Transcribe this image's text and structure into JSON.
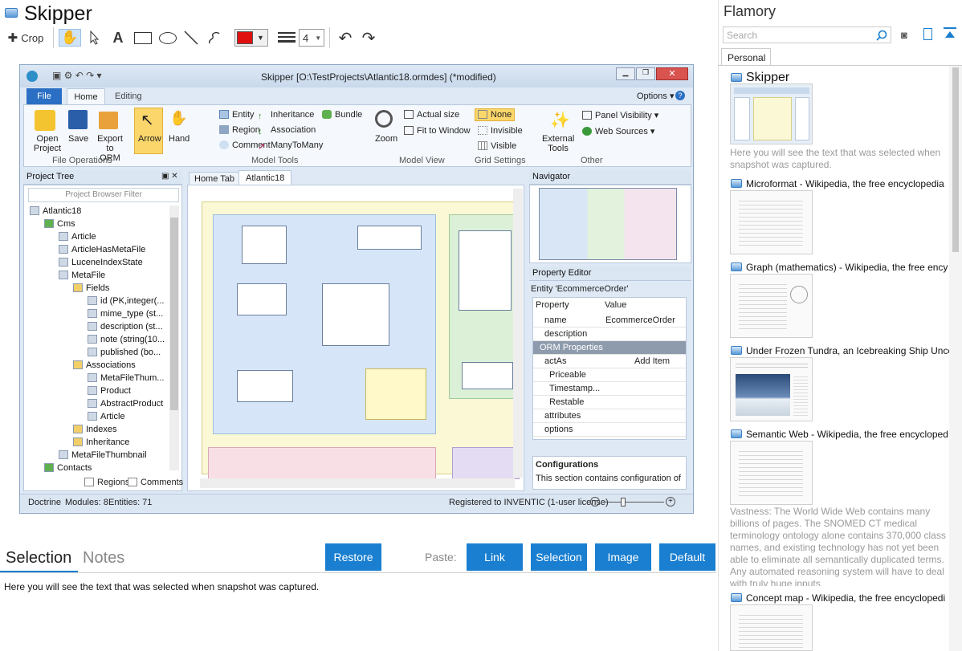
{
  "app": {
    "title": "Skipper"
  },
  "toolbar": {
    "crop_label": "Crop",
    "line_width": "4",
    "color": "#e01010"
  },
  "screenshot": {
    "window_title": "Skipper [O:\\TestProjects\\Atlantic18.ormdes] (*modified)",
    "ribbon_tabs": [
      "File",
      "Home",
      "Editing"
    ],
    "options_label": "Options",
    "file_ops": {
      "open": "Open\nProject",
      "save": "Save",
      "export": "Export\nto ORM",
      "group": "File Operations"
    },
    "arrow": "Arrow",
    "hand": "Hand",
    "model_tools": [
      "Entity",
      "Region",
      "Comment",
      "Inheritance",
      "Association",
      "ManyToMany",
      "Bundle"
    ],
    "model_tools_group": "Model Tools",
    "zoom": "Zoom",
    "actual_size": "Actual size",
    "fit_window": "Fit to Window",
    "model_view_group": "Model View",
    "grid": [
      "None",
      "Invisible",
      "Visible"
    ],
    "grid_group": "Grid Settings",
    "external_tools": "External\nTools",
    "panel_visibility": "Panel Visibility",
    "web_sources": "Web Sources",
    "other_group": "Other",
    "project_tree": "Project Tree",
    "filter_placeholder": "Project Browser Filter",
    "tree_items": [
      {
        "label": "Atlantic18",
        "indent": 0
      },
      {
        "label": "Cms",
        "indent": 1
      },
      {
        "label": "Article",
        "indent": 2
      },
      {
        "label": "ArticleHasMetaFile",
        "indent": 2
      },
      {
        "label": "LuceneIndexState",
        "indent": 2
      },
      {
        "label": "MetaFile",
        "indent": 2
      },
      {
        "label": "Fields",
        "indent": 3
      },
      {
        "label": "id (PK,integer(...",
        "indent": 4
      },
      {
        "label": "mime_type (st...",
        "indent": 4
      },
      {
        "label": "description (st...",
        "indent": 4
      },
      {
        "label": "note (string(10...",
        "indent": 4
      },
      {
        "label": "published (bo...",
        "indent": 4
      },
      {
        "label": "Associations",
        "indent": 3
      },
      {
        "label": "MetaFileThum...",
        "indent": 4
      },
      {
        "label": "Product",
        "indent": 4
      },
      {
        "label": "AbstractProduct",
        "indent": 4
      },
      {
        "label": "Article",
        "indent": 4
      },
      {
        "label": "Indexes",
        "indent": 3
      },
      {
        "label": "Inheritance",
        "indent": 3
      },
      {
        "label": "MetaFileThumbnail",
        "indent": 2
      },
      {
        "label": "Contacts",
        "indent": 1
      }
    ],
    "regions_label": "Regions",
    "comments_label": "Comments",
    "doc_tabs": [
      "Home Tab",
      "Atlantic18"
    ],
    "navigator": "Navigator",
    "property_editor": "Property Editor",
    "entity_label": "Entity 'EcommerceOrder'",
    "prop_header": [
      "Property",
      "Value"
    ],
    "props": [
      {
        "name": "name",
        "value": "EcommerceOrder"
      },
      {
        "name": "description",
        "value": ""
      },
      {
        "name": "ORM Properties",
        "value": ""
      },
      {
        "name": "actAs",
        "value": "Add Item"
      },
      {
        "name": "Priceable",
        "value": ""
      },
      {
        "name": "Timestamp...",
        "value": ""
      },
      {
        "name": "Restable",
        "value": ""
      },
      {
        "name": "attributes",
        "value": ""
      },
      {
        "name": "options",
        "value": ""
      }
    ],
    "config_title": "Configurations",
    "config_text": "This section contains configuration of",
    "status": {
      "left": "Doctrine",
      "modules": "Modules: 8",
      "entities": "Entities: 71",
      "license": "Registered to INVENTIC (1-user license)"
    }
  },
  "bottom": {
    "tab_selection": "Selection",
    "tab_notes": "Notes",
    "restore": "Restore",
    "paste_label": "Paste:",
    "paste_buttons": [
      "Link",
      "Selection",
      "Image",
      "Default"
    ],
    "selection_text": "Here you will see the text that was selected when snapshot was captured."
  },
  "right": {
    "title": "Flamory",
    "search_placeholder": "Search",
    "tab": "Personal",
    "items": [
      {
        "title": "Skipper",
        "desc": "Here you will see the text that was selected when snapshot was captured."
      },
      {
        "title": "Microformat - Wikipedia, the free encyclopedia"
      },
      {
        "title": "Graph (mathematics) - Wikipedia, the free ency"
      },
      {
        "title": "Under Frozen Tundra, an Icebreaking Ship Unco"
      },
      {
        "title": "Semantic Web - Wikipedia, the free encycloped",
        "desc": "Vastness: The World Wide Web contains many billions of pages. The SNOMED CT medical terminology ontology alone contains 370,000 class names, and existing technology has not yet been able to eliminate all semantically duplicated terms. Any automated reasoning system will have to deal with truly huge inputs."
      },
      {
        "title": "Concept map - Wikipedia, the free encyclopedi"
      }
    ]
  }
}
